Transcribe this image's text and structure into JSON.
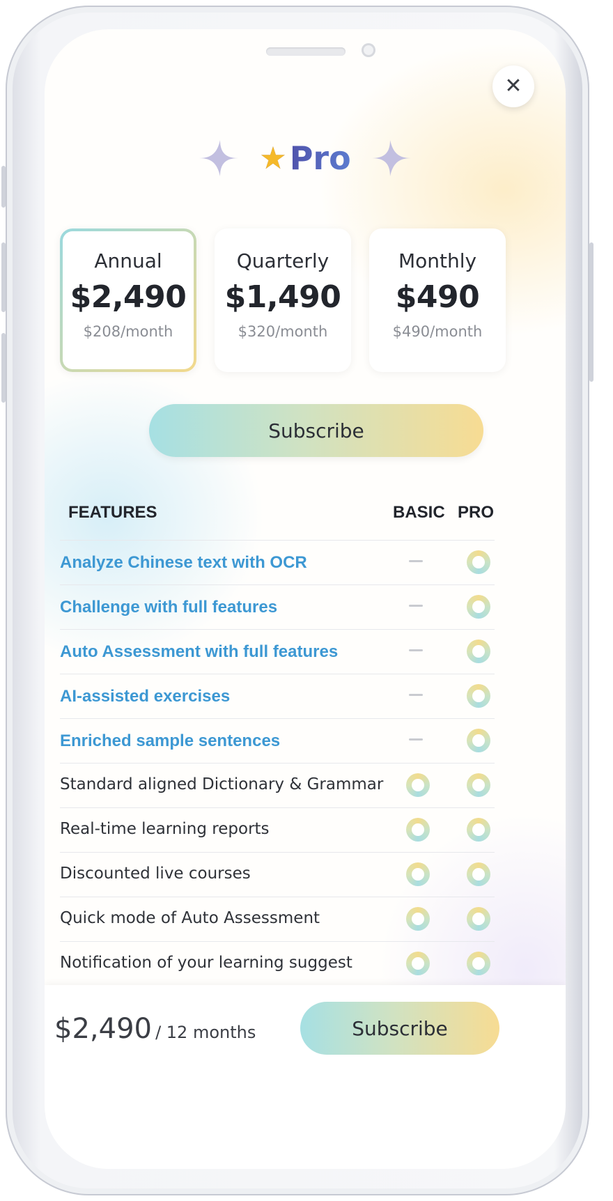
{
  "close_icon": "close-icon",
  "header": {
    "star_icon": "star-icon",
    "title": "Pro"
  },
  "plans": [
    {
      "name": "Annual",
      "price": "$2,490",
      "per_month": "$208/month",
      "selected": true
    },
    {
      "name": "Quarterly",
      "price": "$1,490",
      "per_month": "$320/month",
      "selected": false
    },
    {
      "name": "Monthly",
      "price": "$490",
      "per_month": "$490/month",
      "selected": false
    }
  ],
  "subscribe_label": "Subscribe",
  "features_table": {
    "headers": {
      "feature": "FEATURES",
      "basic": "BASIC",
      "pro": "PRO"
    },
    "rows": [
      {
        "label": "Analyze Chinese text with OCR",
        "basic": false,
        "pro": true,
        "highlight": true
      },
      {
        "label": "Challenge with full features",
        "basic": false,
        "pro": true,
        "highlight": true
      },
      {
        "label": "Auto Assessment with full features",
        "basic": false,
        "pro": true,
        "highlight": true
      },
      {
        "label": "AI-assisted exercises",
        "basic": false,
        "pro": true,
        "highlight": true
      },
      {
        "label": "Enriched sample sentences",
        "basic": false,
        "pro": true,
        "highlight": true
      },
      {
        "label": "Standard aligned Dictionary & Grammar",
        "basic": true,
        "pro": true,
        "highlight": false
      },
      {
        "label": "Real-time learning reports",
        "basic": true,
        "pro": true,
        "highlight": false
      },
      {
        "label": "Discounted live courses",
        "basic": true,
        "pro": true,
        "highlight": false
      },
      {
        "label": "Quick mode of Auto Assessment",
        "basic": true,
        "pro": true,
        "highlight": false
      },
      {
        "label": "Notification of your learning suggest",
        "basic": true,
        "pro": true,
        "highlight": false
      }
    ]
  },
  "footer": {
    "total_price": "$2,490",
    "period": "/ 12 months",
    "subscribe_label": "Subscribe"
  },
  "colors": {
    "feature_highlight": "#3d98d3",
    "title_purple": "#4a3e9a",
    "star": "#f5b92a"
  }
}
